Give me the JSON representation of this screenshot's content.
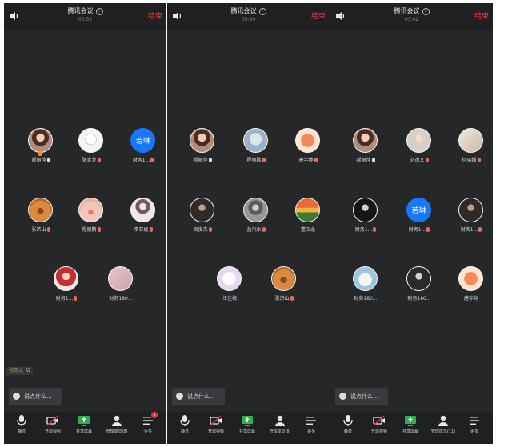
{
  "colors": {
    "bg": "#262729",
    "topbar": "#1f2022",
    "end": "#e53935",
    "accent": "#1677ff"
  },
  "panels": [
    {
      "title": "腾讯会议",
      "timer": "00:32",
      "end_label": "结束",
      "participants": [
        {
          "name": "郝丽萍",
          "mic": "on",
          "avatar": "photo-woman",
          "fire": true
        },
        {
          "name": "张青龙",
          "mic": "off",
          "avatar": "sketch"
        },
        {
          "name": "财务1...",
          "mic": "off",
          "avatar": "text",
          "avatar_text": "若琳"
        },
        {
          "name": "张济山",
          "mic": "off",
          "avatar": "dog"
        },
        {
          "name": "程丽鹏",
          "mic": "off",
          "avatar": "pig-face"
        },
        {
          "name": "李亚妮",
          "mic": "off",
          "avatar": "girl"
        },
        {
          "name": "财务1...",
          "mic": "off",
          "avatar": "kid-red"
        },
        {
          "name": "财务180...",
          "mic": "none",
          "avatar": "pink-blur"
        }
      ],
      "chat_tag": {
        "name": "张青龙",
        "text": "哈"
      },
      "say_placeholder": "说点什么...",
      "toolbar": [
        {
          "icon": "mic-icon",
          "label": "静音"
        },
        {
          "icon": "video-off-icon",
          "label": "开启视频"
        },
        {
          "icon": "share-screen-icon",
          "label": "共享屏幕"
        },
        {
          "icon": "members-icon",
          "label": "管理成员(8)"
        },
        {
          "icon": "more-icon",
          "label": "更多",
          "badge": "1"
        }
      ]
    },
    {
      "title": "腾讯会议",
      "timer": "05:49",
      "end_label": "结束",
      "participants": [
        {
          "name": "郝丽萍",
          "mic": "on",
          "avatar": "photo-woman"
        },
        {
          "name": "程丽鹏",
          "mic": "off",
          "avatar": "plush-toy"
        },
        {
          "name": "唐宇婷",
          "mic": "off",
          "avatar": "cartoon-fox"
        },
        {
          "name": "高俊杰",
          "mic": "off",
          "avatar": "man-dark"
        },
        {
          "name": "盐汽水",
          "mic": "off",
          "avatar": "woman-grey"
        },
        {
          "name": "董玉龙",
          "mic": "none",
          "avatar": "sunset"
        },
        {
          "name": "汪佳梅",
          "mic": "none",
          "avatar": "unicorn"
        },
        {
          "name": "张济山",
          "mic": "off",
          "avatar": "dog"
        }
      ],
      "say_placeholder": "说点什么...",
      "toolbar": [
        {
          "icon": "mic-icon",
          "label": "静音"
        },
        {
          "icon": "video-off-icon",
          "label": "开启视频"
        },
        {
          "icon": "share-screen-icon",
          "label": "共享屏幕"
        },
        {
          "icon": "members-icon",
          "label": "管理成员(8)"
        },
        {
          "icon": "more-icon",
          "label": "更多"
        }
      ]
    },
    {
      "title": "腾讯会议",
      "timer": "03:42",
      "end_label": "结束",
      "participants": [
        {
          "name": "郝丽萍",
          "mic": "on",
          "avatar": "photo-woman"
        },
        {
          "name": "刘逸文",
          "mic": "off",
          "avatar": "woman-light"
        },
        {
          "name": "何瑞娟",
          "mic": "off",
          "avatar": "room"
        },
        {
          "name": "财务1...",
          "mic": "off",
          "avatar": "girl-dark"
        },
        {
          "name": "财务1...",
          "mic": "off",
          "avatar": "text",
          "avatar_text": "若琳"
        },
        {
          "name": "财务1...",
          "mic": "off",
          "avatar": "man-dark"
        },
        {
          "name": "财务180...",
          "mic": "none",
          "avatar": "plush-blue"
        },
        {
          "name": "财务180...",
          "mic": "none",
          "avatar": "bw-portrait"
        },
        {
          "name": "唐宇婷",
          "mic": "none",
          "avatar": "cartoon-fox"
        }
      ],
      "say_placeholder": "说点什么...",
      "toolbar": [
        {
          "icon": "mic-icon",
          "label": "静音"
        },
        {
          "icon": "video-off-icon",
          "label": "开启视频"
        },
        {
          "icon": "share-screen-icon",
          "label": "共享屏幕"
        },
        {
          "icon": "members-icon",
          "label": "管理成员(11)"
        },
        {
          "icon": "more-icon",
          "label": "更多"
        }
      ]
    }
  ]
}
